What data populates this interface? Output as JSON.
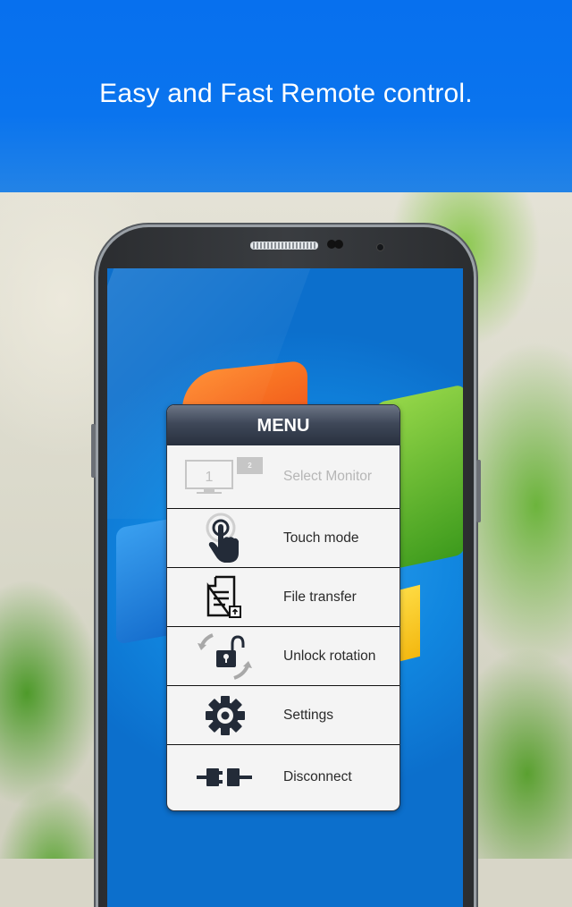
{
  "banner": {
    "title": "Easy and Fast Remote control."
  },
  "menu": {
    "title": "MENU",
    "items": [
      {
        "label": "Select Monitor",
        "icon": "monitor-select-icon",
        "enabled": false,
        "monitor_primary": "1",
        "monitor_secondary": "2"
      },
      {
        "label": "Touch mode",
        "icon": "touch-hand-icon",
        "enabled": true
      },
      {
        "label": "File transfer",
        "icon": "file-transfer-icon",
        "enabled": true
      },
      {
        "label": "Unlock rotation",
        "icon": "unlock-rotation-icon",
        "enabled": true
      },
      {
        "label": "Settings",
        "icon": "gear-icon",
        "enabled": true
      },
      {
        "label": "Disconnect",
        "icon": "plug-disconnect-icon",
        "enabled": true
      }
    ]
  },
  "colors": {
    "banner_blue": "#0770ee",
    "menu_header": "#3f4859",
    "icon_dark": "#232b38",
    "disabled_gray": "#b6b6b6"
  }
}
